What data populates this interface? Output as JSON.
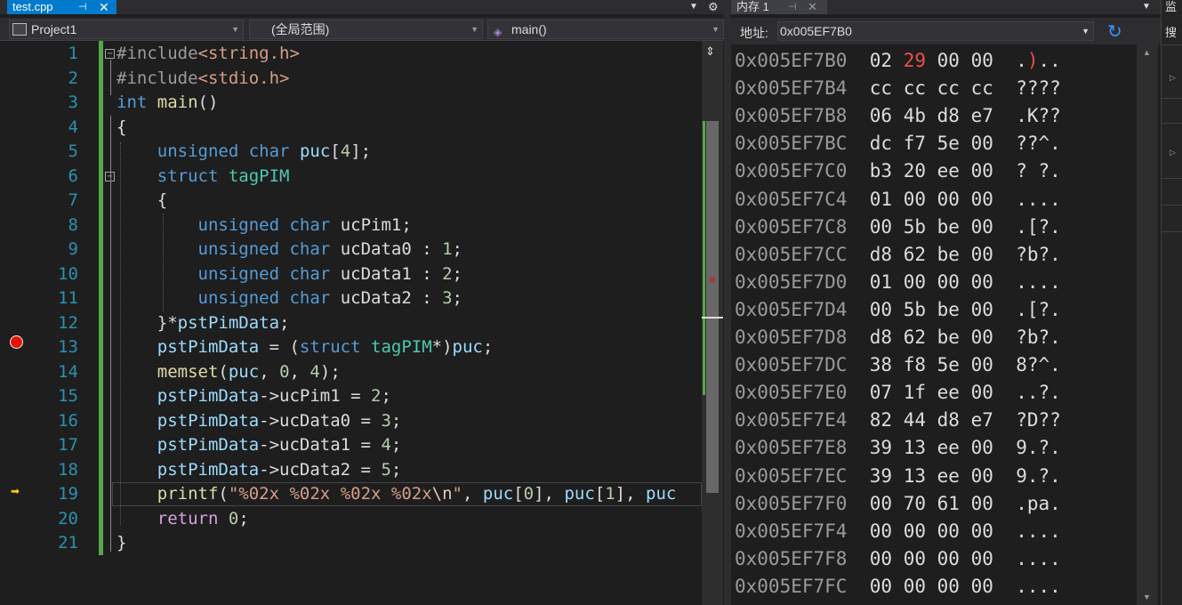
{
  "editor": {
    "tab_label": "test.cpp",
    "tab_pin": "⊣",
    "tab_close": "✕",
    "tab_dropdown": "▼",
    "settings_glyph": "⚙",
    "project": "Project1",
    "scope": "(全局范围)",
    "function": "main()",
    "dropdown_arrow": "▼",
    "split_glyph": "⇕",
    "line_numbers": [
      "1",
      "2",
      "3",
      "4",
      "5",
      "6",
      "7",
      "8",
      "9",
      "10",
      "11",
      "12",
      "13",
      "14",
      "15",
      "16",
      "17",
      "18",
      "19",
      "20",
      "21"
    ],
    "breakpoint_line": 13,
    "current_line": 19,
    "current_line_marker": "➡",
    "fold_glyph": "−",
    "code": [
      [
        {
          "t": "#include",
          "c": "pp"
        },
        {
          "t": "<string.h>",
          "c": "str"
        }
      ],
      [
        {
          "t": "#include",
          "c": "pp"
        },
        {
          "t": "<stdio.h>",
          "c": "str"
        }
      ],
      [
        {
          "t": "int",
          "c": "kw"
        },
        {
          "t": " ",
          "c": ""
        },
        {
          "t": "main",
          "c": "fn"
        },
        {
          "t": "()",
          "c": ""
        }
      ],
      [
        {
          "t": "{",
          "c": ""
        }
      ],
      [
        {
          "t": "    ",
          "c": ""
        },
        {
          "t": "unsigned",
          "c": "kw"
        },
        {
          "t": " ",
          "c": ""
        },
        {
          "t": "char",
          "c": "kw"
        },
        {
          "t": " ",
          "c": ""
        },
        {
          "t": "puc",
          "c": "var"
        },
        {
          "t": "[",
          "c": ""
        },
        {
          "t": "4",
          "c": "num"
        },
        {
          "t": "];",
          "c": ""
        }
      ],
      [
        {
          "t": "    ",
          "c": ""
        },
        {
          "t": "struct",
          "c": "kw"
        },
        {
          "t": " ",
          "c": ""
        },
        {
          "t": "tagPIM",
          "c": "ty"
        }
      ],
      [
        {
          "t": "    {",
          "c": ""
        }
      ],
      [
        {
          "t": "        ",
          "c": ""
        },
        {
          "t": "unsigned",
          "c": "kw"
        },
        {
          "t": " ",
          "c": ""
        },
        {
          "t": "char",
          "c": "kw"
        },
        {
          "t": " ucPim1;",
          "c": ""
        }
      ],
      [
        {
          "t": "        ",
          "c": ""
        },
        {
          "t": "unsigned",
          "c": "kw"
        },
        {
          "t": " ",
          "c": ""
        },
        {
          "t": "char",
          "c": "kw"
        },
        {
          "t": " ucData0 : ",
          "c": ""
        },
        {
          "t": "1",
          "c": "num"
        },
        {
          "t": ";",
          "c": ""
        }
      ],
      [
        {
          "t": "        ",
          "c": ""
        },
        {
          "t": "unsigned",
          "c": "kw"
        },
        {
          "t": " ",
          "c": ""
        },
        {
          "t": "char",
          "c": "kw"
        },
        {
          "t": " ucData1 : ",
          "c": ""
        },
        {
          "t": "2",
          "c": "num"
        },
        {
          "t": ";",
          "c": ""
        }
      ],
      [
        {
          "t": "        ",
          "c": ""
        },
        {
          "t": "unsigned",
          "c": "kw"
        },
        {
          "t": " ",
          "c": ""
        },
        {
          "t": "char",
          "c": "kw"
        },
        {
          "t": " ucData2 : ",
          "c": ""
        },
        {
          "t": "3",
          "c": "num"
        },
        {
          "t": ";",
          "c": ""
        }
      ],
      [
        {
          "t": "    }*",
          "c": ""
        },
        {
          "t": "pstPimData",
          "c": "var"
        },
        {
          "t": ";",
          "c": ""
        }
      ],
      [
        {
          "t": "    ",
          "c": ""
        },
        {
          "t": "pstPimData",
          "c": "var"
        },
        {
          "t": " = (",
          "c": ""
        },
        {
          "t": "struct",
          "c": "kw"
        },
        {
          "t": " ",
          "c": ""
        },
        {
          "t": "tagPIM",
          "c": "ty"
        },
        {
          "t": "*)",
          "c": ""
        },
        {
          "t": "puc",
          "c": "var"
        },
        {
          "t": ";",
          "c": ""
        }
      ],
      [
        {
          "t": "    ",
          "c": ""
        },
        {
          "t": "memset",
          "c": "fn"
        },
        {
          "t": "(",
          "c": ""
        },
        {
          "t": "puc",
          "c": "var"
        },
        {
          "t": ", ",
          "c": ""
        },
        {
          "t": "0",
          "c": "num"
        },
        {
          "t": ", ",
          "c": ""
        },
        {
          "t": "4",
          "c": "num"
        },
        {
          "t": ");",
          "c": ""
        }
      ],
      [
        {
          "t": "    ",
          "c": ""
        },
        {
          "t": "pstPimData",
          "c": "var"
        },
        {
          "t": "->ucPim1 = ",
          "c": ""
        },
        {
          "t": "2",
          "c": "num"
        },
        {
          "t": ";",
          "c": ""
        }
      ],
      [
        {
          "t": "    ",
          "c": ""
        },
        {
          "t": "pstPimData",
          "c": "var"
        },
        {
          "t": "->ucData0 = ",
          "c": ""
        },
        {
          "t": "3",
          "c": "num"
        },
        {
          "t": ";",
          "c": ""
        }
      ],
      [
        {
          "t": "    ",
          "c": ""
        },
        {
          "t": "pstPimData",
          "c": "var"
        },
        {
          "t": "->ucData1 = ",
          "c": ""
        },
        {
          "t": "4",
          "c": "num"
        },
        {
          "t": ";",
          "c": ""
        }
      ],
      [
        {
          "t": "    ",
          "c": ""
        },
        {
          "t": "pstPimData",
          "c": "var"
        },
        {
          "t": "->ucData2 = ",
          "c": ""
        },
        {
          "t": "5",
          "c": "num"
        },
        {
          "t": ";",
          "c": ""
        }
      ],
      [
        {
          "t": "    ",
          "c": ""
        },
        {
          "t": "printf",
          "c": "fn"
        },
        {
          "t": "(",
          "c": ""
        },
        {
          "t": "\"%02x %02x %02x %02x",
          "c": "str"
        },
        {
          "t": "\\n",
          "c": "esc"
        },
        {
          "t": "\"",
          "c": "str"
        },
        {
          "t": ", ",
          "c": ""
        },
        {
          "t": "puc",
          "c": "var"
        },
        {
          "t": "[",
          "c": ""
        },
        {
          "t": "0",
          "c": "num"
        },
        {
          "t": "], ",
          "c": ""
        },
        {
          "t": "puc",
          "c": "var"
        },
        {
          "t": "[",
          "c": ""
        },
        {
          "t": "1",
          "c": "num"
        },
        {
          "t": "], ",
          "c": ""
        },
        {
          "t": "puc",
          "c": "var"
        }
      ],
      [
        {
          "t": "    ",
          "c": ""
        },
        {
          "t": "return",
          "c": "ctl"
        },
        {
          "t": " ",
          "c": ""
        },
        {
          "t": "0",
          "c": "num"
        },
        {
          "t": ";",
          "c": ""
        }
      ],
      [
        {
          "t": "}",
          "c": ""
        }
      ]
    ]
  },
  "memory": {
    "tab_label": "内存 1",
    "tab_pin": "⊣",
    "tab_close": "✕",
    "dropdown": "▼",
    "address_label": "地址:",
    "address_value": "0x005EF7B0",
    "refresh_glyph": "↻",
    "changed_color": "#f14c4c",
    "rows": [
      {
        "addr": "0x005EF7B0",
        "bytes": [
          "02",
          "29",
          "00",
          "00"
        ],
        "changed": [
          1
        ],
        "ascii": ".).."
      },
      {
        "addr": "0x005EF7B4",
        "bytes": [
          "cc",
          "cc",
          "cc",
          "cc"
        ],
        "changed": [],
        "ascii": "????"
      },
      {
        "addr": "0x005EF7B8",
        "bytes": [
          "06",
          "4b",
          "d8",
          "e7"
        ],
        "changed": [],
        "ascii": ".K??"
      },
      {
        "addr": "0x005EF7BC",
        "bytes": [
          "dc",
          "f7",
          "5e",
          "00"
        ],
        "changed": [],
        "ascii": "??^."
      },
      {
        "addr": "0x005EF7C0",
        "bytes": [
          "b3",
          "20",
          "ee",
          "00"
        ],
        "changed": [],
        "ascii": "? ?."
      },
      {
        "addr": "0x005EF7C4",
        "bytes": [
          "01",
          "00",
          "00",
          "00"
        ],
        "changed": [],
        "ascii": "...."
      },
      {
        "addr": "0x005EF7C8",
        "bytes": [
          "00",
          "5b",
          "be",
          "00"
        ],
        "changed": [],
        "ascii": ".[?."
      },
      {
        "addr": "0x005EF7CC",
        "bytes": [
          "d8",
          "62",
          "be",
          "00"
        ],
        "changed": [],
        "ascii": "?b?."
      },
      {
        "addr": "0x005EF7D0",
        "bytes": [
          "01",
          "00",
          "00",
          "00"
        ],
        "changed": [],
        "ascii": "...."
      },
      {
        "addr": "0x005EF7D4",
        "bytes": [
          "00",
          "5b",
          "be",
          "00"
        ],
        "changed": [],
        "ascii": ".[?."
      },
      {
        "addr": "0x005EF7D8",
        "bytes": [
          "d8",
          "62",
          "be",
          "00"
        ],
        "changed": [],
        "ascii": "?b?."
      },
      {
        "addr": "0x005EF7DC",
        "bytes": [
          "38",
          "f8",
          "5e",
          "00"
        ],
        "changed": [],
        "ascii": "8?^."
      },
      {
        "addr": "0x005EF7E0",
        "bytes": [
          "07",
          "1f",
          "ee",
          "00"
        ],
        "changed": [],
        "ascii": "..?."
      },
      {
        "addr": "0x005EF7E4",
        "bytes": [
          "82",
          "44",
          "d8",
          "e7"
        ],
        "changed": [],
        "ascii": "?D??"
      },
      {
        "addr": "0x005EF7E8",
        "bytes": [
          "39",
          "13",
          "ee",
          "00"
        ],
        "changed": [],
        "ascii": "9.?."
      },
      {
        "addr": "0x005EF7EC",
        "bytes": [
          "39",
          "13",
          "ee",
          "00"
        ],
        "changed": [],
        "ascii": "9.?."
      },
      {
        "addr": "0x005EF7F0",
        "bytes": [
          "00",
          "70",
          "61",
          "00"
        ],
        "changed": [],
        "ascii": ".pa."
      },
      {
        "addr": "0x005EF7F4",
        "bytes": [
          "00",
          "00",
          "00",
          "00"
        ],
        "changed": [],
        "ascii": "...."
      },
      {
        "addr": "0x005EF7F8",
        "bytes": [
          "00",
          "00",
          "00",
          "00"
        ],
        "changed": [],
        "ascii": "...."
      },
      {
        "addr": "0x005EF7FC",
        "bytes": [
          "00",
          "00",
          "00",
          "00"
        ],
        "changed": [],
        "ascii": "...."
      }
    ]
  },
  "watch": {
    "title": "监",
    "search": "搜",
    "expand_glyph": "▷"
  }
}
